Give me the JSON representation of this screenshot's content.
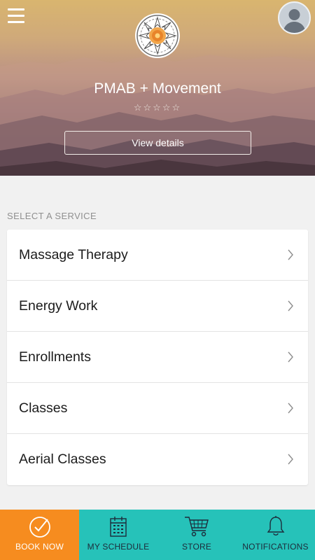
{
  "header": {
    "business_name": "PMAB + Movement",
    "rating_stars": "☆☆☆☆☆",
    "view_details_label": "View details"
  },
  "icons": {
    "menu": "hamburger-menu-icon",
    "avatar": "user-avatar-icon",
    "logo": "mandala-logo",
    "chevron": "chevron-right-icon"
  },
  "services": {
    "section_label": "SELECT A SERVICE",
    "items": [
      {
        "label": "Massage Therapy"
      },
      {
        "label": "Energy Work"
      },
      {
        "label": "Enrollments"
      },
      {
        "label": "Classes"
      },
      {
        "label": "Aerial Classes"
      }
    ]
  },
  "bottom_nav": {
    "items": [
      {
        "label": "BOOK NOW",
        "icon": "checkmark-circle-icon",
        "active": true
      },
      {
        "label": "MY SCHEDULE",
        "icon": "calendar-icon",
        "active": false
      },
      {
        "label": "STORE",
        "icon": "cart-icon",
        "active": false
      },
      {
        "label": "NOTIFICATIONS",
        "icon": "bell-icon",
        "active": false
      }
    ]
  },
  "colors": {
    "accent_orange": "#f68c1f",
    "nav_teal": "#26c2b9",
    "page_background": "#f1f1f1"
  }
}
